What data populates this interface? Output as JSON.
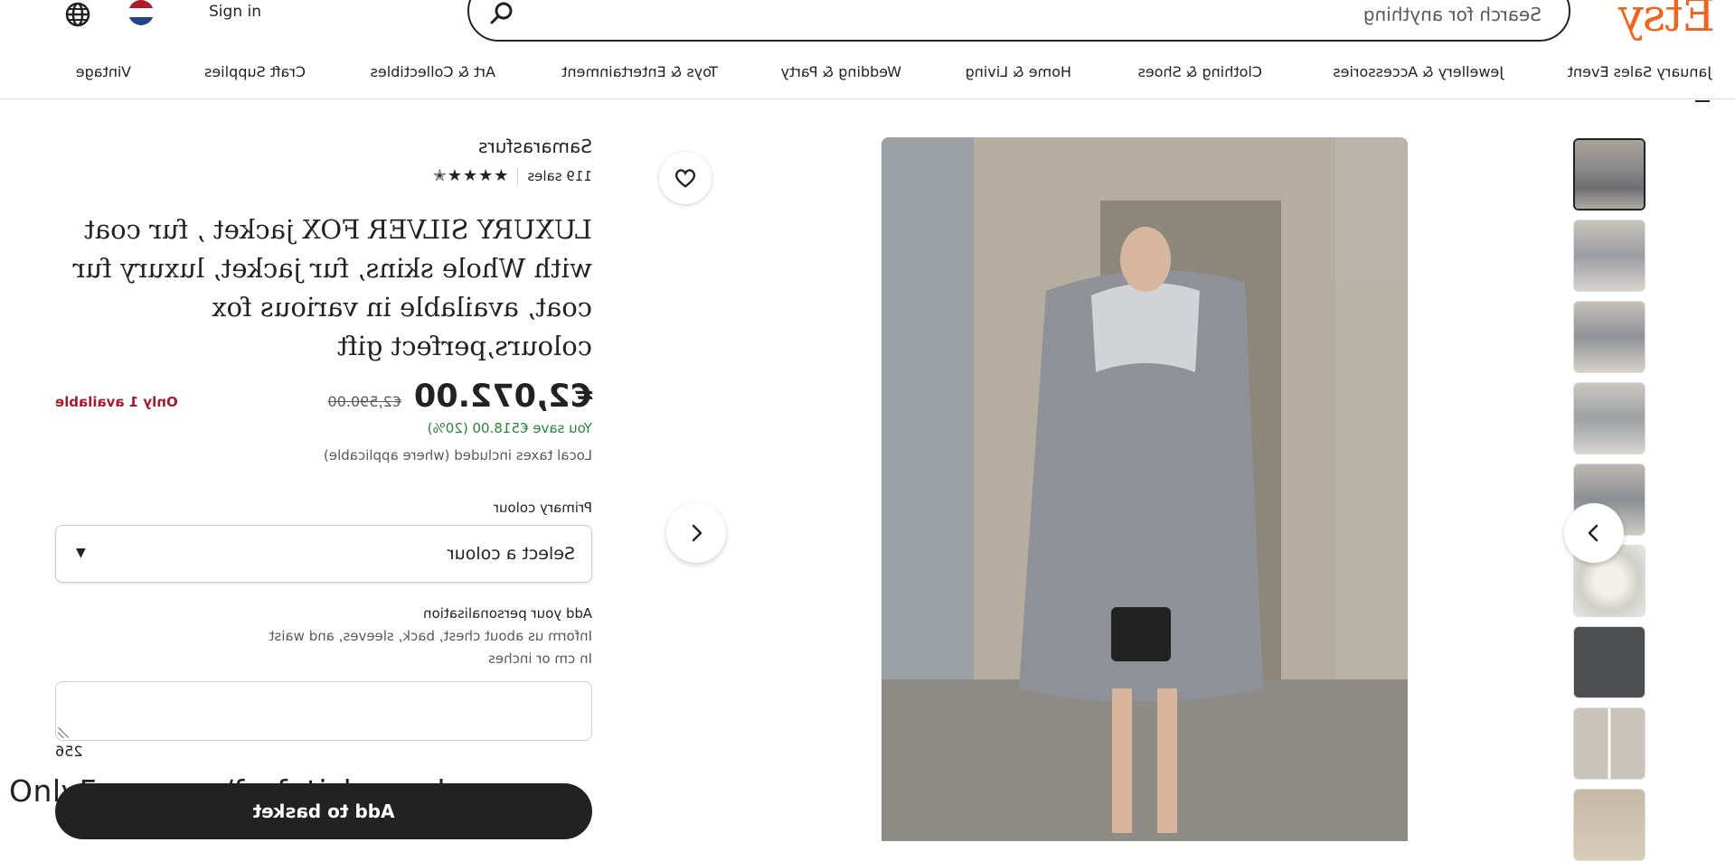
{
  "header": {
    "logo": "Etsy",
    "search_placeholder": "Search for anything",
    "sign_in": "Sign in",
    "search_icon": "search-icon",
    "globe_icon": "globe-icon",
    "flag_icon": "netherlands-flag-icon"
  },
  "categories": [
    "January Sales Event",
    "Jewellery & Accessories",
    "Clothing & Shoes",
    "Home & Living",
    "Wedding & Party",
    "Toys & Entertainment",
    "Art & Collectibles",
    "Craft Supplies",
    "Vintage"
  ],
  "gallery": {
    "prev_icon": "chevron-left-icon",
    "next_icon": "chevron-right-icon",
    "favorite_icon": "heart-icon"
  },
  "listing": {
    "shop_name": "Samarasfurs",
    "sales": "119 sales",
    "rating_stars": "★★★★✭",
    "title": "LUXURY SILVER FOX jacket , fur coat with Whole skins, fur jacket, luxury fur coat, available in various fox colours,perfect gift",
    "price": "€2,072.00",
    "original_price": "€2,590.00",
    "availability": "Only 1 available",
    "savings": "You save €518.00 (20%)",
    "tax_note": "Local taxes included (where applicable)",
    "primary_colour_label": "Primary colour",
    "select_value": "Select a colour",
    "personalisation_label": "Add your personalisation",
    "personalisation_help_1": "Inform us about chest, back, sleeves, and waist",
    "personalisation_help_2": "In cm or inches",
    "char_counter": "256",
    "add_to_basket": "Add to basket"
  },
  "colors": {
    "brand": "#F1641E",
    "sale_green": "#258635",
    "alert_red": "#A61A2E"
  },
  "watermark": "OnlyFans.com/furfetishcouple"
}
